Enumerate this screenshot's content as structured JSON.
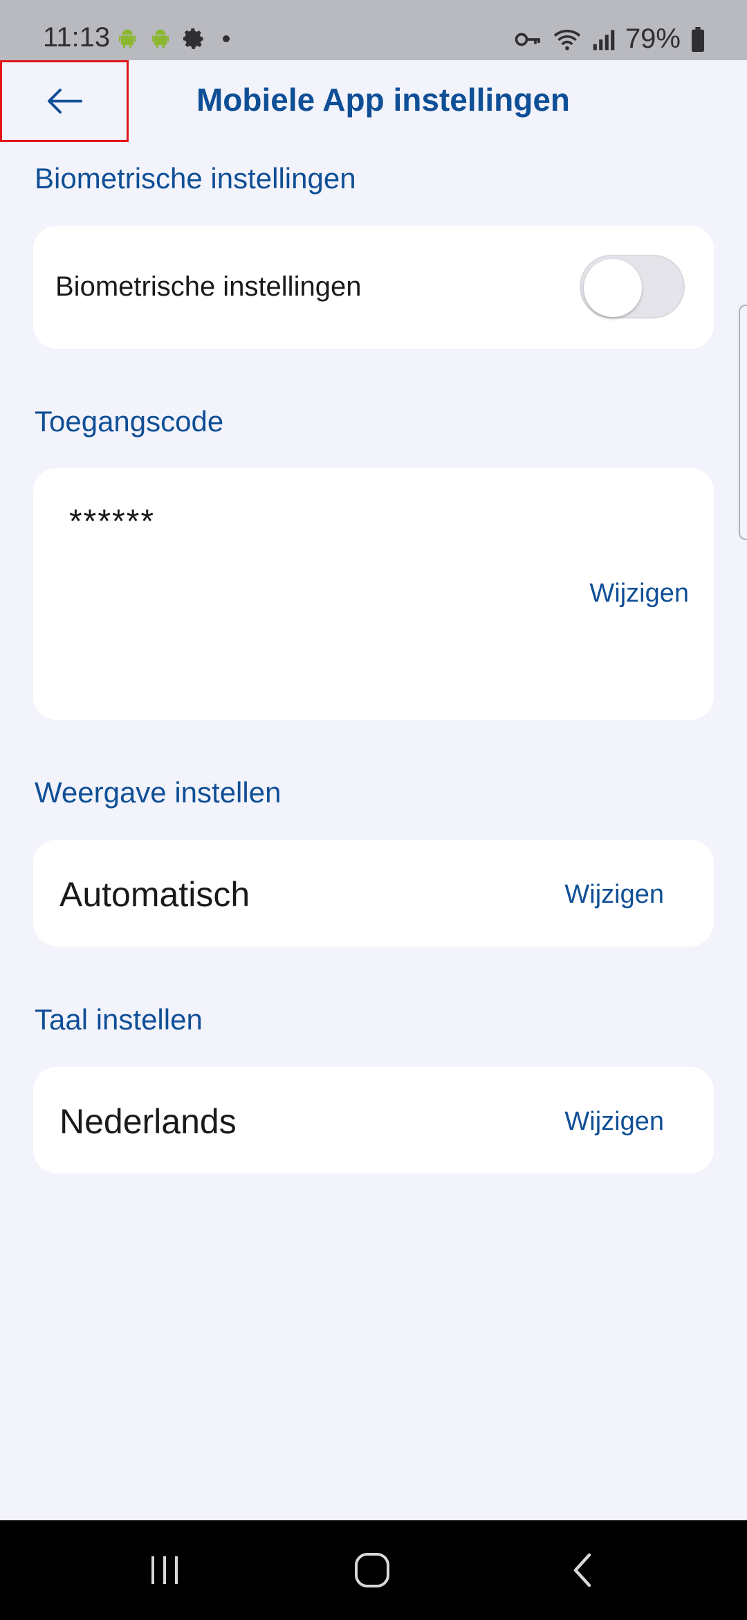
{
  "status_bar": {
    "time": "11:13",
    "battery": "79%",
    "left_icons": [
      "android-icon",
      "android-icon",
      "gear-icon",
      "dot-icon"
    ],
    "right_icons": [
      "key-icon",
      "wifi-icon",
      "signal-icon",
      "battery-icon"
    ]
  },
  "app_bar": {
    "title": "Mobiele App instellingen",
    "back_icon": "arrow-left-icon"
  },
  "sections": {
    "biometric": {
      "title": "Biometrische instellingen",
      "label": "Biometrische instellingen",
      "toggle_on": false
    },
    "passcode": {
      "title": "Toegangscode",
      "value": "******",
      "action": "Wijzigen"
    },
    "display": {
      "title": "Weergave instellen",
      "value": "Automatisch",
      "action": "Wijzigen"
    },
    "language": {
      "title": "Taal instellen",
      "value": "Nederlands",
      "action": "Wijzigen"
    }
  },
  "nav_bar": {
    "buttons": [
      "recents-icon",
      "home-icon",
      "back-icon"
    ]
  },
  "colors": {
    "accent": "#0f4f96",
    "background": "#f3f3fb",
    "card": "#ffffff",
    "highlight": "#e2141a"
  }
}
